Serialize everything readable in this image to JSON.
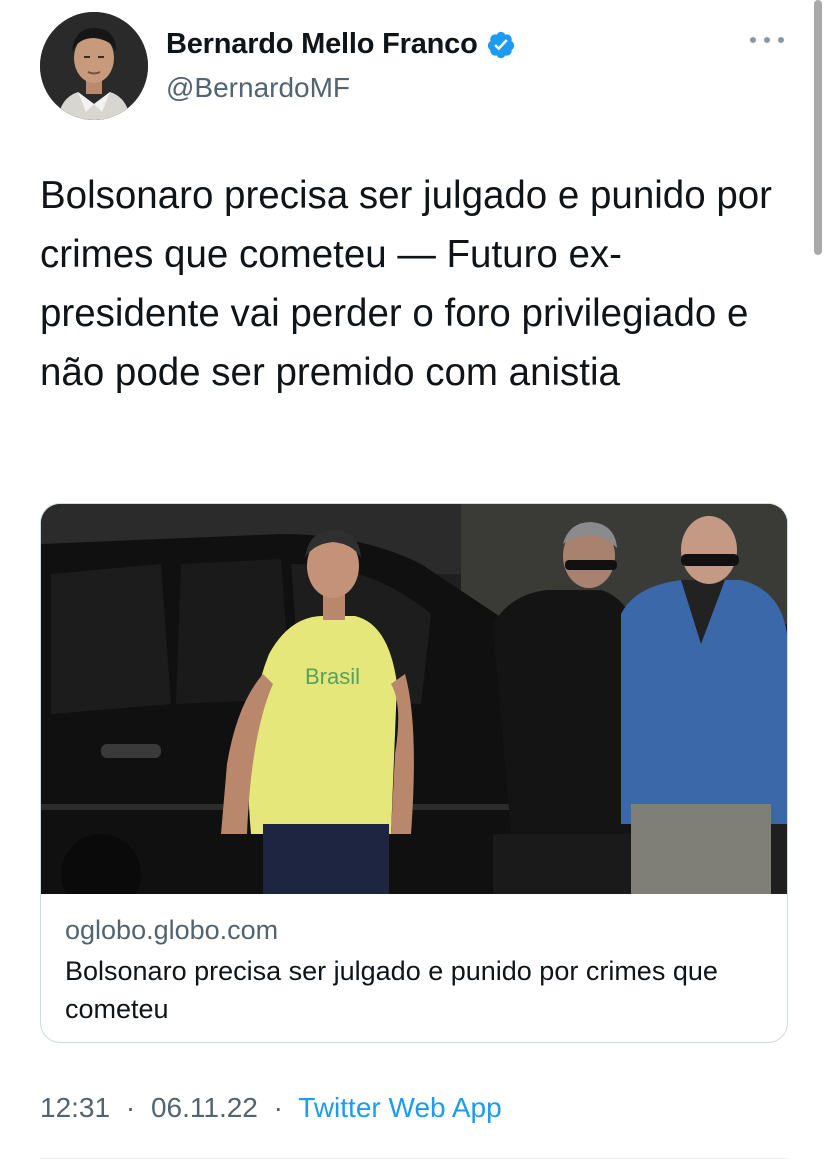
{
  "author": {
    "display_name": "Bernardo Mello Franco",
    "handle": "@BernardoMF",
    "verified": true,
    "avatar_icon": "avatar-photo"
  },
  "tweet": {
    "text": "Bolsonaro precisa ser julgado e punido por crimes que cometeu — Futuro ex-presidente vai perder o foro privilegiado e não pode ser premido com anistia"
  },
  "card": {
    "domain": "oglobo.globo.com",
    "title": "Bolsonaro precisa ser julgado e punido por crimes que cometeu",
    "photo_icon": "news-photo",
    "shirt_text": "Brasil"
  },
  "meta": {
    "time": "12:31",
    "separator": "·",
    "date": "06.11.22",
    "source": "Twitter Web App"
  },
  "colors": {
    "text": "#0f1419",
    "secondary": "#536471",
    "accent": "#1d9bf0",
    "border": "#cfd9de"
  }
}
